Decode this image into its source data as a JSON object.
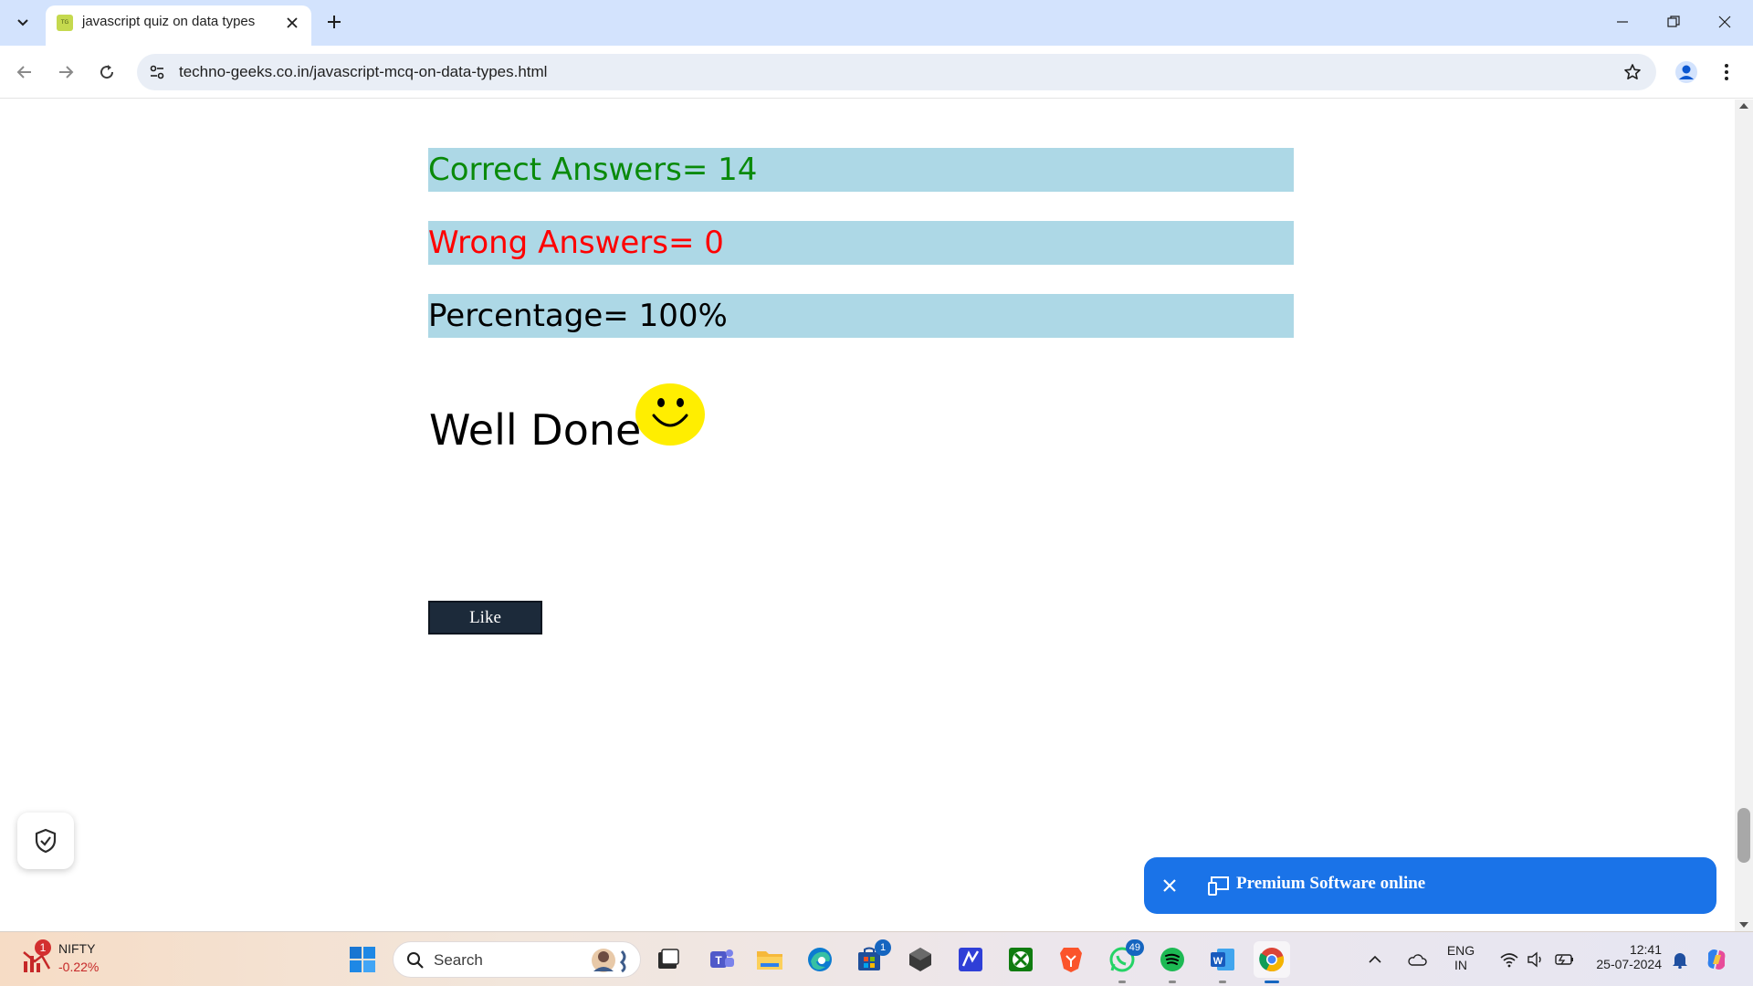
{
  "browser": {
    "tab_title": "javascript quiz on data types",
    "favicon_text": "TG",
    "url": "techno-geeks.co.in/javascript-mcq-on-data-types.html"
  },
  "results": {
    "correct_label": "Correct Answers= 14",
    "wrong_label": "Wrong Answers= 0",
    "percentage_label": "Percentage= 100%",
    "correct_count": 14,
    "wrong_count": 0,
    "percentage": 100,
    "message": "Well Done",
    "like_label": "Like"
  },
  "colors": {
    "bar_background": "#add8e6",
    "correct_text": "#0a8a0a",
    "wrong_text": "#ff0000",
    "like_button": "#1c2a3a",
    "premium_banner": "#1a73e8",
    "smiley": "#ffee00"
  },
  "premium": {
    "label": "Premium Software online"
  },
  "taskbar": {
    "nifty_name": "NIFTY",
    "nifty_change": "-0.22%",
    "nifty_badge": "1",
    "search_placeholder": "Search",
    "store_badge": "1",
    "whatsapp_badge": "49",
    "lang_top": "ENG",
    "lang_bottom": "IN",
    "time": "12:41",
    "date": "25-07-2024"
  }
}
